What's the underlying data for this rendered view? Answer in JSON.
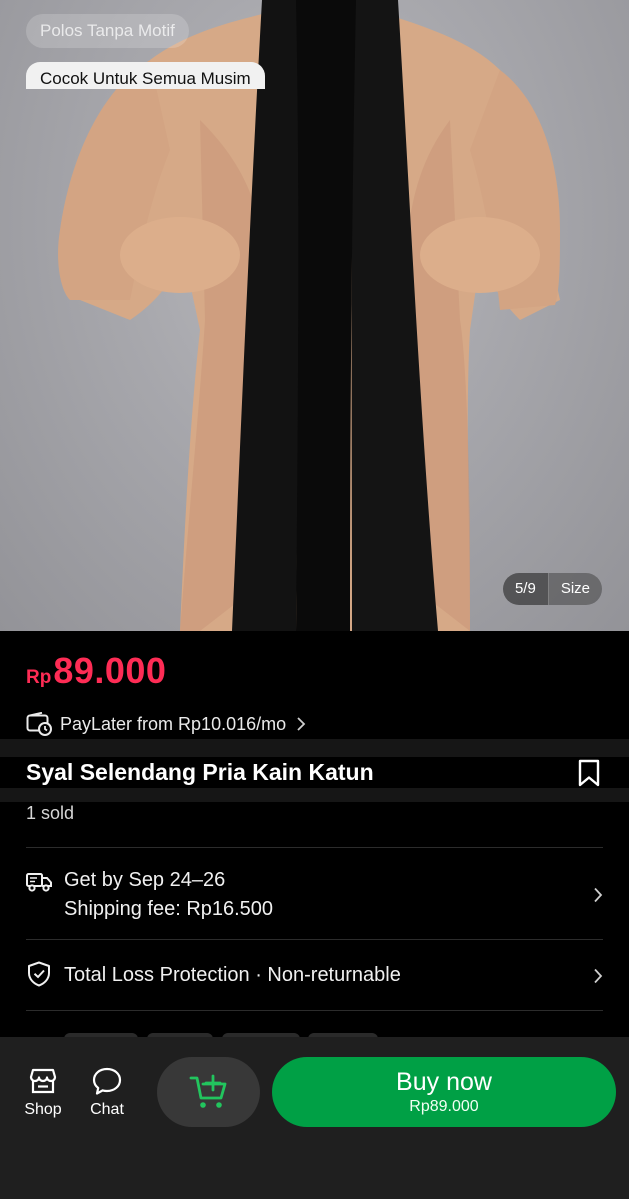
{
  "product_image": {
    "tags": [
      "Polos Tanpa Motif",
      "Cocok Untuk Semua Musim"
    ],
    "counter": "5/9",
    "size_label": "Size"
  },
  "price": {
    "currency": "Rp",
    "value": "89.000"
  },
  "paylater": {
    "text": "PayLater from Rp10.016/mo",
    "icon": "wallet-clock-icon"
  },
  "product": {
    "title": "Syal Selendang Pria Kain Katun",
    "sold": "1 sold"
  },
  "shipping": {
    "delivery": "Get by Sep 24–26",
    "fee": "Shipping fee: Rp16.500",
    "icon": "delivery-truck-icon"
  },
  "protection": {
    "text": "Total Loss Protection · Non-returnable",
    "icon": "shield-check-icon"
  },
  "bottom_bar": {
    "shop_label": "Shop",
    "chat_label": "Chat",
    "buy_label": "Buy now",
    "buy_price": "Rp89.000"
  },
  "colors": {
    "price": "#fe2c55",
    "buy_button": "#00a045",
    "cart_icon": "#22c55e",
    "background": "#000000"
  }
}
